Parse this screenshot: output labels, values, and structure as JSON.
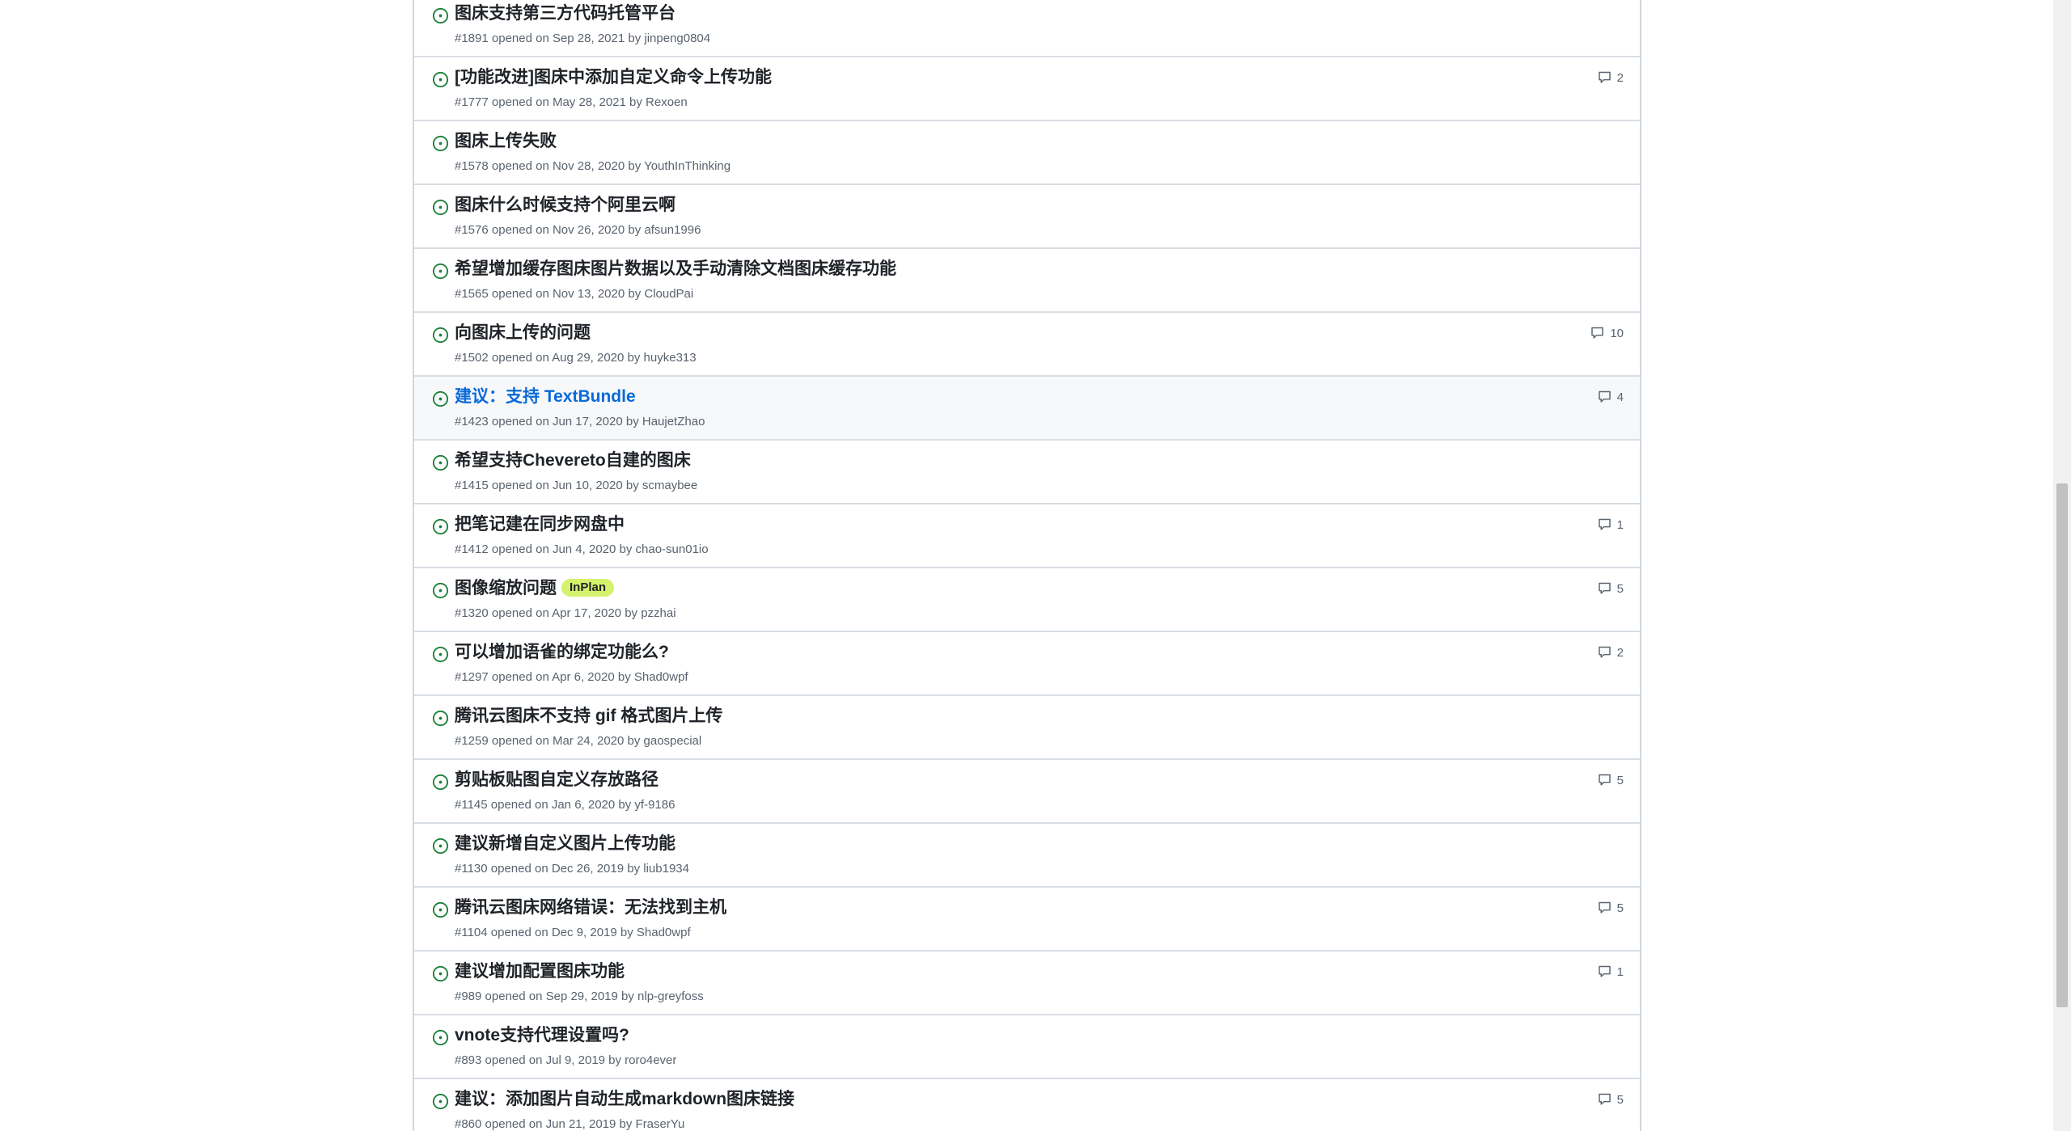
{
  "issues": [
    {
      "title": "图床支持第三方代码托管平台",
      "meta": "#1891 opened on Sep 28, 2021 by jinpeng0804",
      "comments": "",
      "label": ""
    },
    {
      "title": "[功能改进]图床中添加自定义命令上传功能",
      "meta": "#1777 opened on May 28, 2021 by Rexoen",
      "comments": "2",
      "label": ""
    },
    {
      "title": "图床上传失败",
      "meta": "#1578 opened on Nov 28, 2020 by YouthInThinking",
      "comments": "",
      "label": ""
    },
    {
      "title": "图床什么时候支持个阿里云啊",
      "meta": "#1576 opened on Nov 26, 2020 by afsun1996",
      "comments": "",
      "label": ""
    },
    {
      "title": "希望增加缓存图床图片数据以及手动清除文档图床缓存功能",
      "meta": "#1565 opened on Nov 13, 2020 by CloudPai",
      "comments": "",
      "label": ""
    },
    {
      "title": "向图床上传的问题",
      "meta": "#1502 opened on Aug 29, 2020 by huyke313",
      "comments": "10",
      "label": ""
    },
    {
      "title": "建议：支持 TextBundle",
      "meta": "#1423 opened on Jun 17, 2020 by HaujetZhao",
      "comments": "4",
      "label": ""
    },
    {
      "title": "希望支持Chevereto自建的图床",
      "meta": "#1415 opened on Jun 10, 2020 by scmaybee",
      "comments": "",
      "label": ""
    },
    {
      "title": "把笔记建在同步网盘中",
      "meta": "#1412 opened on Jun 4, 2020 by chao-sun01io",
      "comments": "1",
      "label": ""
    },
    {
      "title": "图像缩放问题",
      "meta": "#1320 opened on Apr 17, 2020 by pzzhai",
      "comments": "5",
      "label": "InPlan"
    },
    {
      "title": "可以增加语雀的绑定功能么?",
      "meta": "#1297 opened on Apr 6, 2020 by Shad0wpf",
      "comments": "2",
      "label": ""
    },
    {
      "title": "腾讯云图床不支持 gif 格式图片上传",
      "meta": "#1259 opened on Mar 24, 2020 by gaospecial",
      "comments": "",
      "label": ""
    },
    {
      "title": "剪贴板贴图自定义存放路径",
      "meta": "#1145 opened on Jan 6, 2020 by yf-9186",
      "comments": "5",
      "label": ""
    },
    {
      "title": "建议新增自定义图片上传功能",
      "meta": "#1130 opened on Dec 26, 2019 by liub1934",
      "comments": "",
      "label": ""
    },
    {
      "title": "腾讯云图床网络错误：无法找到主机",
      "meta": "#1104 opened on Dec 9, 2019 by Shad0wpf",
      "comments": "5",
      "label": ""
    },
    {
      "title": "建议增加配置图床功能",
      "meta": "#989 opened on Sep 29, 2019 by nlp-greyfoss",
      "comments": "1",
      "label": ""
    },
    {
      "title": "vnote支持代理设置吗?",
      "meta": "#893 opened on Jul 9, 2019 by roro4ever",
      "comments": "",
      "label": ""
    },
    {
      "title": "建议：添加图片自动生成markdown图床链接",
      "meta": "#860 opened on Jun 21, 2019 by FraserYu",
      "comments": "5",
      "label": ""
    }
  ],
  "colors": {
    "open_icon": "#1a7f37",
    "link_hover": "#0969da",
    "label_inplan": "#d4f26b"
  },
  "icons": {
    "status": "issue-opened-icon",
    "comment": "comment-icon"
  }
}
